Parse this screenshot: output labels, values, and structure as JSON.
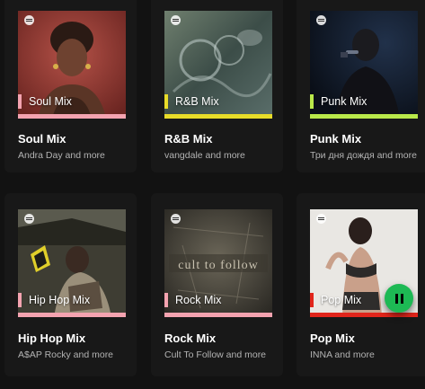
{
  "mixes": [
    {
      "title": "Soul Mix",
      "tag": "Soul Mix",
      "subtitle": "Andra Day and more",
      "accent": "#f4a3b0"
    },
    {
      "title": "R&B Mix",
      "tag": "R&B Mix",
      "subtitle": "vangdale and more",
      "accent": "#e8dc29"
    },
    {
      "title": "Punk Mix",
      "tag": "Punk Mix",
      "subtitle": "Три дня дождя and more",
      "accent": "#b9e84a"
    },
    {
      "title": "Hip Hop Mix",
      "tag": "Hip Hop Mix",
      "subtitle": "A$AP Rocky and more",
      "accent": "#f4a3b0"
    },
    {
      "title": "Rock Mix",
      "tag": "Rock Mix",
      "subtitle": "Cult To Follow and more",
      "accent": "#f4a3b0"
    },
    {
      "title": "Pop Mix",
      "tag": "Pop Mix",
      "subtitle": "INNA and more",
      "accent": "#e1251b"
    }
  ],
  "rock_cover_text": "cult to follow",
  "icons": {
    "play": "pause-icon",
    "brand": "spotify-logo-icon"
  }
}
